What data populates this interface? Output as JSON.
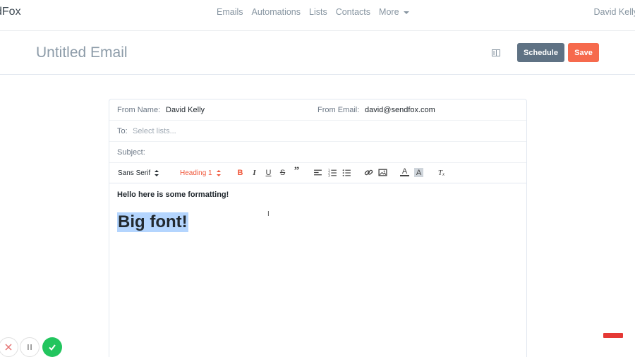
{
  "nav": {
    "brand": "dFox",
    "links": [
      "Emails",
      "Automations",
      "Lists",
      "Contacts"
    ],
    "more_label": "More",
    "user": "David Kelly"
  },
  "header": {
    "title": "Untitled Email",
    "schedule_label": "Schedule",
    "save_label": "Save"
  },
  "form": {
    "from_name_label": "From Name:",
    "from_name_value": "David Kelly",
    "from_email_label": "From Email:",
    "from_email_value": "david@sendfox.com",
    "to_label": "To:",
    "to_placeholder": "Select lists...",
    "subject_label": "Subject:"
  },
  "toolbar": {
    "font": "Sans Serif",
    "heading": "Heading 1",
    "heading_color": "#f0573a"
  },
  "editor": {
    "line1": "Hello here is some formatting!",
    "heading": "Big font!"
  },
  "colors": {
    "accent": "#f66a4d",
    "schedule": "#5f7284",
    "success": "#22c55e",
    "selection": "#b4d5fe"
  }
}
